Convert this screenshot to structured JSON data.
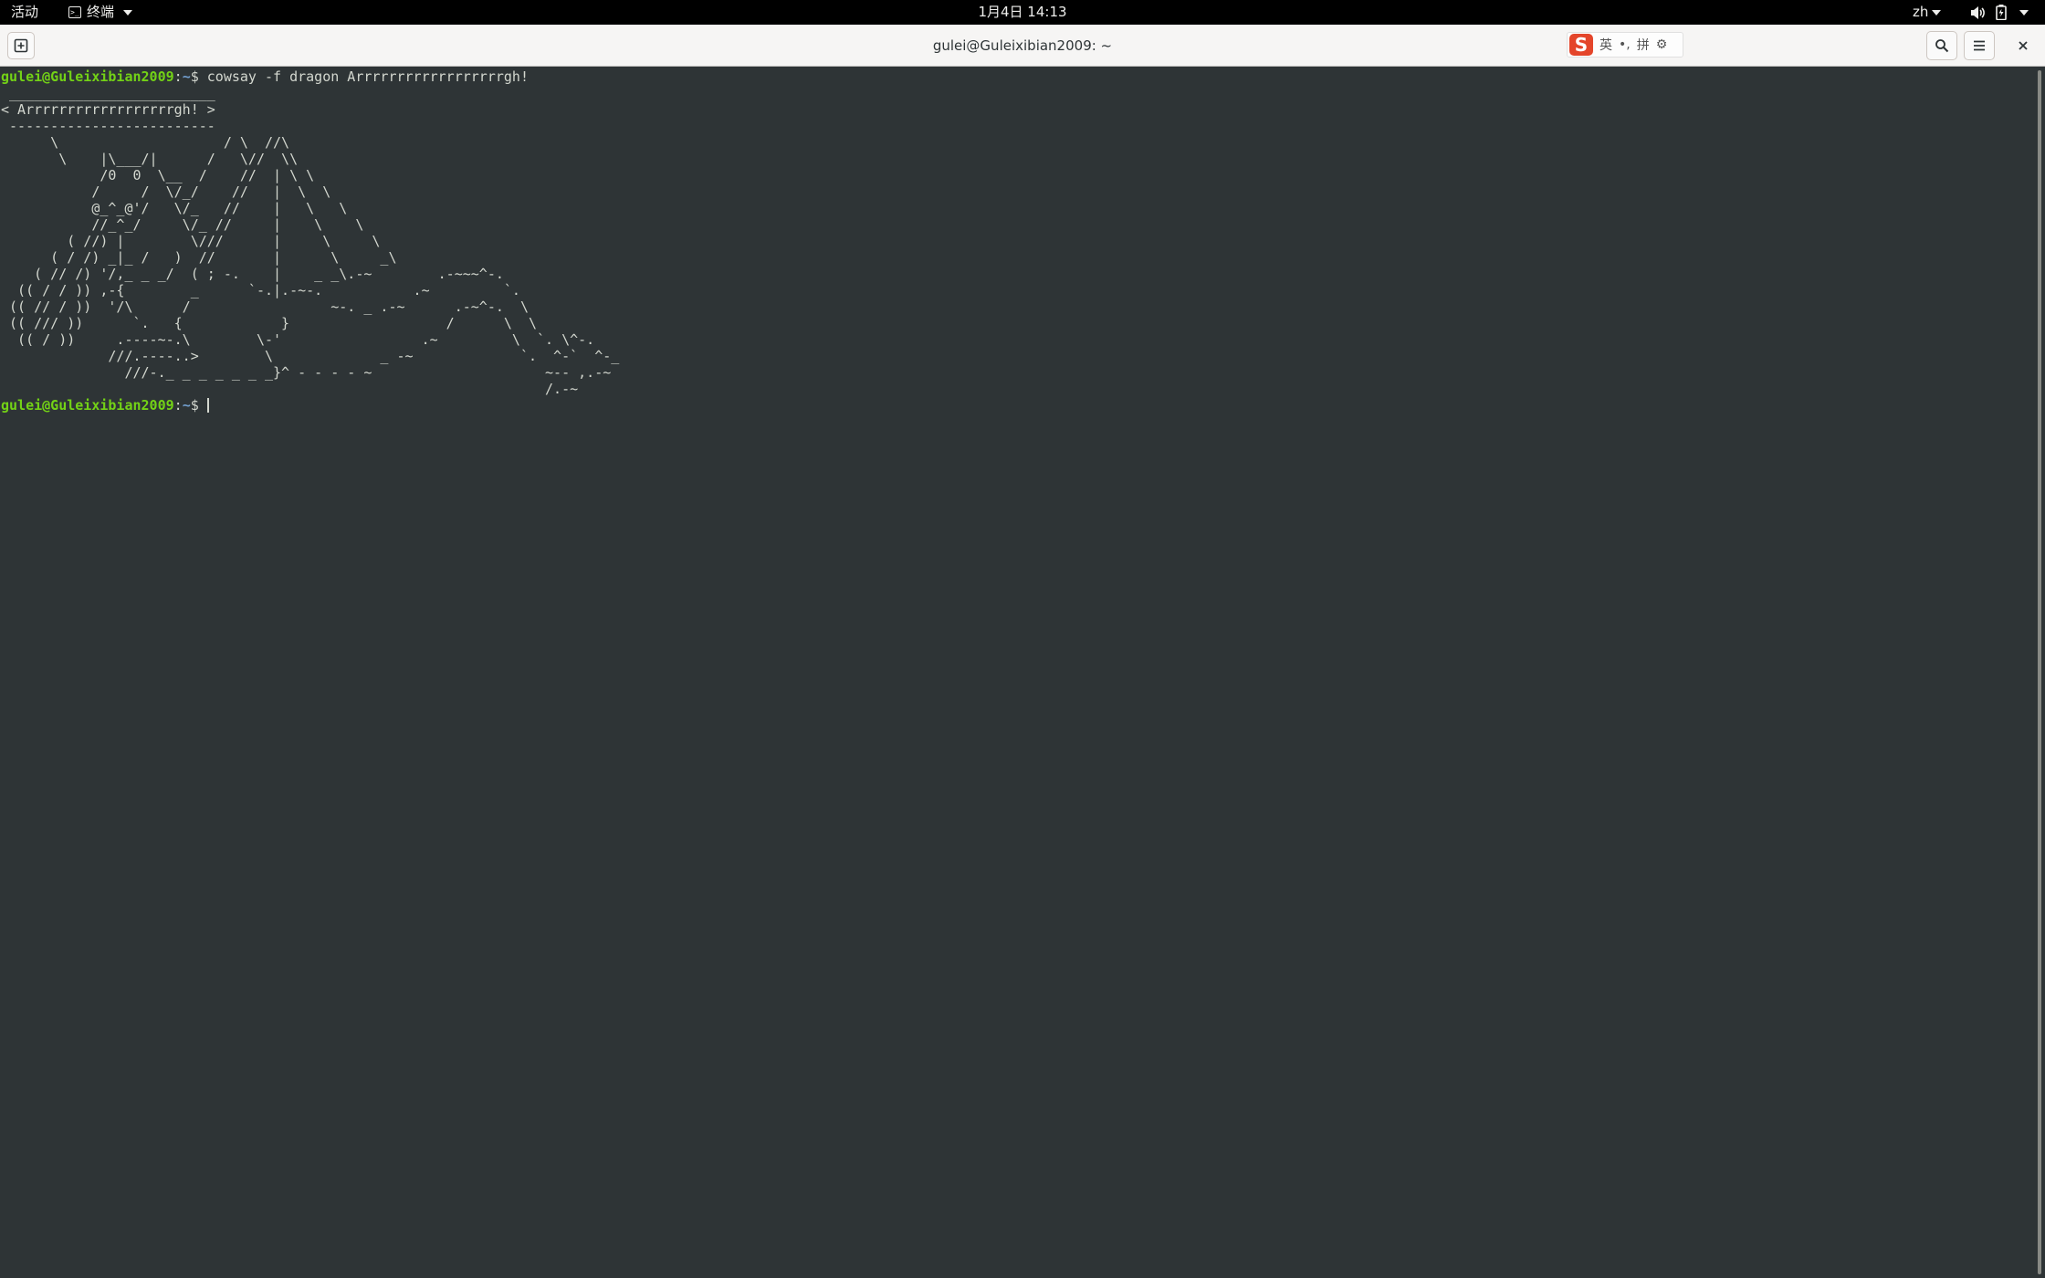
{
  "topbar": {
    "activities": "活动",
    "app_name": "终端",
    "clock": "1月4日 14:13",
    "lang": "zh"
  },
  "window": {
    "title": "gulei@Guleixibian2009: ~"
  },
  "ime": {
    "logo": "S",
    "mode": "英",
    "punct": "•,",
    "pinyin": "拼",
    "settings_glyph": "⚙"
  },
  "terminal": {
    "prompt_user": "gulei@Guleixibian2009",
    "prompt_path": "~",
    "prompt_sep": ":",
    "prompt_dollar": "$ ",
    "command": "cowsay -f dragon Arrrrrrrrrrrrrrrrrrgh!",
    "output": " _________________________\n< Arrrrrrrrrrrrrrrrrrgh! >\n -------------------------\n      \\                    / \\  //\\\n       \\    |\\___/|      /   \\//  \\\\\n            /0  0  \\__  /    //  | \\ \\\n           /     /  \\/_/    //   |  \\  \\\n           @_^_@'/   \\/_   //    |   \\   \\\n           //_^_/     \\/_ //     |    \\    \\\n        ( //) |        \\///      |     \\     \\\n      ( / /) _|_ /   )  //       |      \\     _\\\n    ( // /) '/,_ _ _/  ( ; -.    |    _ _\\.-~        .-~~~^-.\n  (( / / )) ,-{        _      `-.|.-~-.           .~         `.\n (( // / ))  '/\\      /                 ~-. _ .-~      .-~^-.  \\\n (( /// ))      `.   {            }                   /      \\  \\\n  (( / ))     .----~-.\\        \\-'                 .~         \\  `. \\^-.\n             ///.----..>        \\             _ -~             `.  ^-`  ^-_\n               ///-._ _ _ _ _ _ _}^ - - - - ~                     ~-- ,.-~\n                                                                  /.-~",
    "final_command": ""
  }
}
